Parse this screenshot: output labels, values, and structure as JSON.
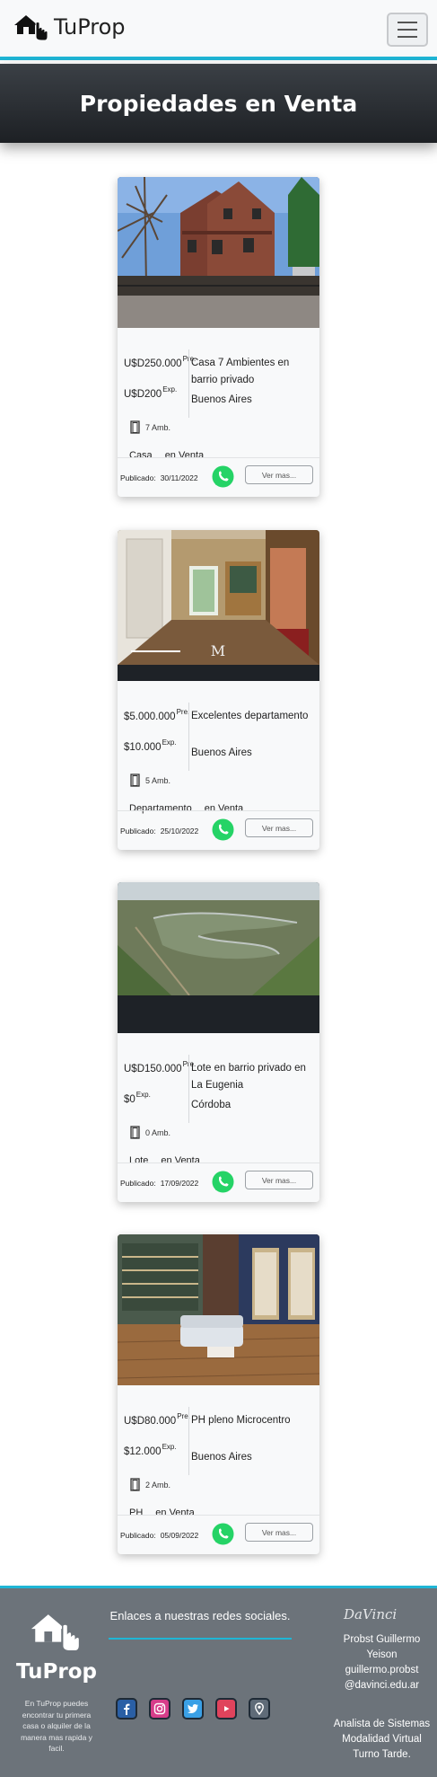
{
  "brand": {
    "name": "TuProp"
  },
  "hero": {
    "title": "Propiedades en Venta"
  },
  "listings": [
    {
      "price": "U$D250.000",
      "price_suffix": "Pre.",
      "expensas": "U$D200",
      "expensas_suffix": "Exp.",
      "title": "Casa 7 Ambientes en barrio privado",
      "city": "Buenos Aires",
      "ambientes": "7 Amb.",
      "type": "Casa",
      "operation": "en Venta",
      "published_label": "Publicado:",
      "date": "30/11/2022",
      "cta": "Ver mas..."
    },
    {
      "price": "$5.000.000",
      "price_suffix": "Pre.",
      "expensas": "$10.000",
      "expensas_suffix": "Exp.",
      "title": "Excelentes departamento",
      "city": "Buenos Aires",
      "ambientes": "5 Amb.",
      "type": "Departamento",
      "operation": "en Venta",
      "published_label": "Publicado:",
      "date": "25/10/2022",
      "cta": "Ver mas...",
      "watermark": "MARTIN PINUS"
    },
    {
      "price": "U$D150.000",
      "price_suffix": "Pre.",
      "expensas": "$0",
      "expensas_suffix": "Exp.",
      "title": "Lote en barrio privado en La Eugenia",
      "city": "Córdoba",
      "ambientes": "0 Amb.",
      "type": "Lote",
      "operation": "en Venta",
      "published_label": "Publicado:",
      "date": "17/09/2022",
      "cta": "Ver mas..."
    },
    {
      "price": "U$D80.000",
      "price_suffix": "Pre.",
      "expensas": "$12.000",
      "expensas_suffix": "Exp.",
      "title": "PH pleno Microcentro",
      "city": "Buenos Aires",
      "ambientes": "2 Amb.",
      "type": "PH",
      "operation": "en Venta",
      "published_label": "Publicado:",
      "date": "05/09/2022",
      "cta": "Ver mas..."
    }
  ],
  "footer": {
    "brand": "TuProp",
    "description": "En TuProp puedes encontrar tu primera casa o alquiler de la manera mas rapida y facil.",
    "links_title": "Enlaces a nuestras redes sociales.",
    "socials": [
      "facebook-icon",
      "instagram-icon",
      "twitter-icon",
      "youtube-icon",
      "location-icon"
    ],
    "davinci": "DaVinci",
    "author_name": "Probst Guillermo Yeison",
    "author_email": "guillermo.probst @davinci.edu.ar",
    "course": "Analista de Sistemas Modalidad Virtual Turno Tarde.",
    "colors": {
      "accent": "#1fb6d6",
      "whatsapp": "#25d366"
    }
  }
}
